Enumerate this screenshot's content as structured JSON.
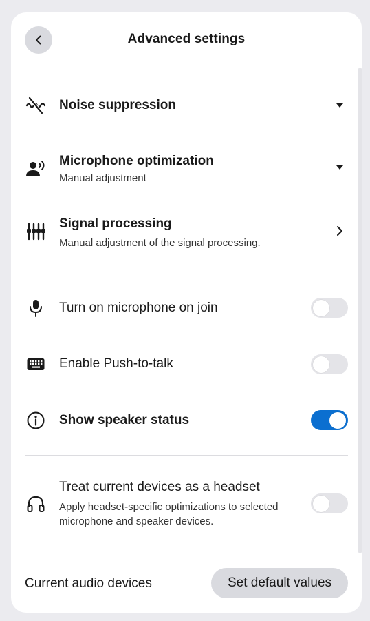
{
  "header": {
    "title": "Advanced settings",
    "back_icon": "chevron-left-icon"
  },
  "audio": {
    "noise_suppression": {
      "label": "Noise suppression",
      "icon": "noise-off-icon",
      "trailing_icon": "caret-down-icon"
    },
    "mic_optimization": {
      "label": "Microphone optimization",
      "sublabel": "Manual adjustment",
      "icon": "voice-person-icon",
      "trailing_icon": "caret-down-icon"
    },
    "signal_processing": {
      "label": "Signal processing",
      "sublabel": "Manual adjustment of the signal processing.",
      "icon": "equalizer-icon",
      "trailing_icon": "chevron-right-icon"
    }
  },
  "toggles": {
    "mic_on_join": {
      "label": "Turn on microphone on join",
      "icon": "microphone-icon",
      "checked": false
    },
    "push_to_talk": {
      "label": "Enable Push-to-talk",
      "icon": "keyboard-icon",
      "checked": false
    },
    "speaker_status": {
      "label": "Show speaker status",
      "icon": "info-icon",
      "checked": true
    }
  },
  "headset": {
    "label": "Treat current devices as a headset",
    "sublabel": "Apply headset-specific optimizations to selected microphone and speaker devices.",
    "icon": "headset-icon",
    "checked": false
  },
  "footer": {
    "devices_label": "Current audio devices",
    "default_button": "Set default values"
  },
  "colors": {
    "accent": "#0b6fd0",
    "background": "#ebebef",
    "panel": "#ffffff",
    "button_bg": "#d9dadf"
  }
}
